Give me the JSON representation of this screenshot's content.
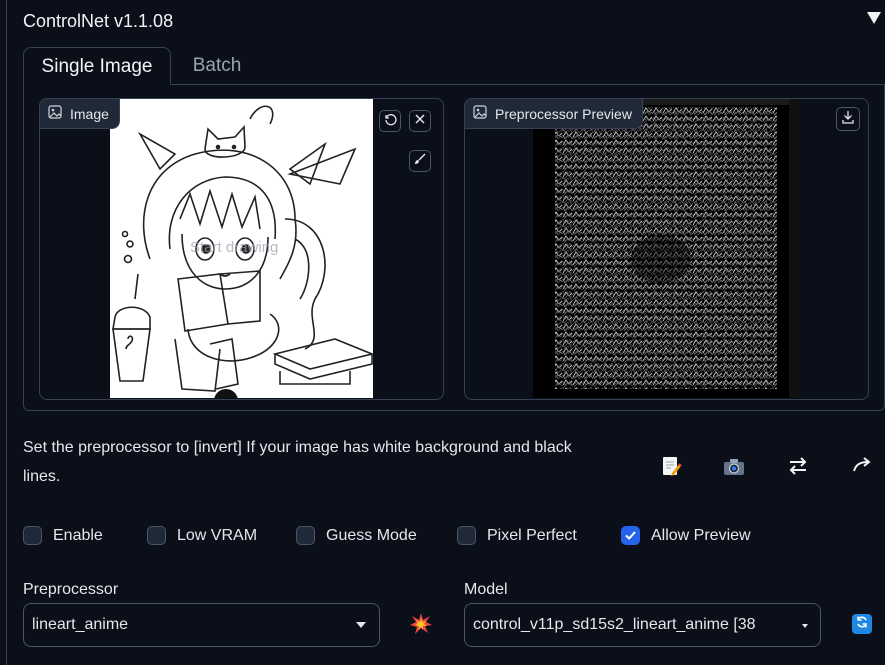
{
  "header": {
    "title": "ControlNet v1.1.08",
    "collapse_icon": "triangle-down-icon"
  },
  "tabs": [
    {
      "label": "Single Image",
      "active": true
    },
    {
      "label": "Batch",
      "active": false
    }
  ],
  "image_input": {
    "label": "Image",
    "canvas_hint": "Start drawing",
    "buttons": [
      "undo-icon",
      "close-icon",
      "brush-icon"
    ]
  },
  "preview": {
    "label": "Preprocessor Preview",
    "buttons": [
      "download-icon"
    ]
  },
  "hint": {
    "line1": "Set the preprocessor to [invert] If your image has white background and black",
    "line2": "lines."
  },
  "tools": [
    "memo-icon",
    "camera-icon",
    "swap-arrows-icon",
    "arrow-up-right-icon"
  ],
  "options": [
    {
      "label": "Enable",
      "checked": false
    },
    {
      "label": "Low VRAM",
      "checked": false
    },
    {
      "label": "Guess Mode",
      "checked": false
    },
    {
      "label": "Pixel Perfect",
      "checked": false
    },
    {
      "label": "Allow Preview",
      "checked": true
    }
  ],
  "preprocessor": {
    "label": "Preprocessor",
    "value": "lineart_anime",
    "run_icon": "explosion-icon"
  },
  "model": {
    "label": "Model",
    "value": "control_v11p_sd15s2_lineart_anime [38",
    "refresh_icon": "refresh-icon"
  },
  "colors": {
    "background": "#0b0f19",
    "accent": "#2563eb",
    "border": "#374151",
    "refresh": "#1e88e5"
  }
}
